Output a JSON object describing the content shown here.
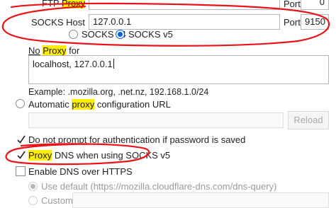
{
  "ftp": {
    "label_prefix": "FTP ",
    "label_hl": "Proxy",
    "port_label": "Port",
    "port_value": "0"
  },
  "socks": {
    "host_label": "SOCKS Host",
    "host_value": "127.0.0.1",
    "port_label": "Port",
    "port_value": "9150",
    "v4_label": "SOCKS v4",
    "v5_label": "SOCKS v5",
    "selected": "v5"
  },
  "no_proxy": {
    "label_no": "No",
    "label_space": " ",
    "label_proxy": "Proxy",
    "label_rest": " for",
    "value": "localhost, 127.0.0.1",
    "example": "Example: .mozilla.org, .net.nz, 192.168.1.0/24"
  },
  "auto_config": {
    "label_prefix": "Automatic ",
    "label_hl": "proxy",
    "label_rest": " configuration URL",
    "value": "",
    "reload_label": "Reload"
  },
  "options": {
    "no_auth_prompt": {
      "label": "Do not prompt for authentication if password is saved",
      "checked": true
    },
    "proxy_dns": {
      "label_hl": "Proxy",
      "label_rest": " DNS when using SOCKS v5",
      "checked": true
    },
    "doh": {
      "label": "Enable DNS over HTTPS",
      "checked": false
    }
  },
  "doh": {
    "use_default_label": "Use default (https://mozilla.cloudflare-dns.com/dns-query)",
    "custom_label": "Custom",
    "custom_value": ""
  },
  "colors": {
    "highlight": "#ffee00",
    "accent": "#0060df",
    "annotation": "#e8141a"
  }
}
